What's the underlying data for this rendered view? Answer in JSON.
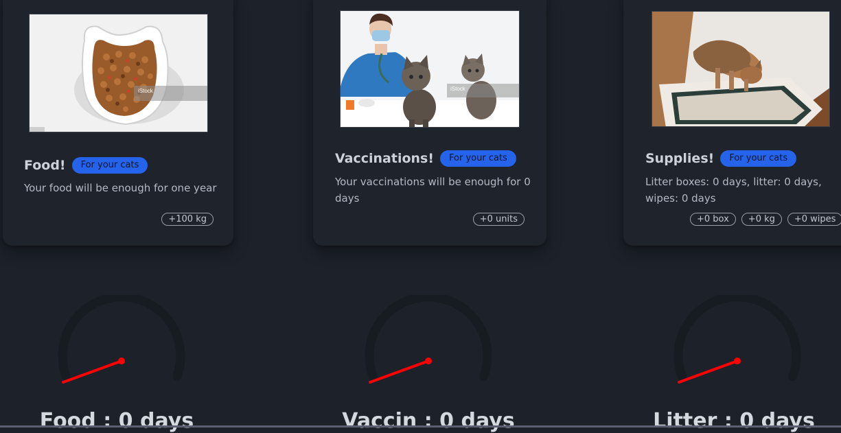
{
  "cards": [
    {
      "title": "Food!",
      "badge": "For your cats",
      "description": "Your food will be enough for one year",
      "chips": [
        "+100 kg"
      ],
      "image_watermark": "iStock"
    },
    {
      "title": "Vaccinations!",
      "badge": "For your cats",
      "description": "Your vaccinations will be enough for 0 days",
      "chips": [
        "+0 units"
      ],
      "image_watermark": "iStock"
    },
    {
      "title": "Supplies!",
      "badge": "For your cats",
      "description": "Litter boxes: 0 days, litter: 0 days, wipes: 0 days",
      "chips": [
        "+0 box",
        "+0 kg",
        "+0 wipes"
      ]
    }
  ],
  "gauges": [
    {
      "label": "Food : 0 days",
      "value_days": 0
    },
    {
      "label": "Vaccin : 0 days",
      "value_days": 0
    },
    {
      "label": "Litter : 0 days",
      "value_days": 0
    }
  ],
  "colors": {
    "background": "#1c212a",
    "badge": "#2563eb",
    "gauge_track": "#171b22",
    "needle": "#ff0000"
  }
}
